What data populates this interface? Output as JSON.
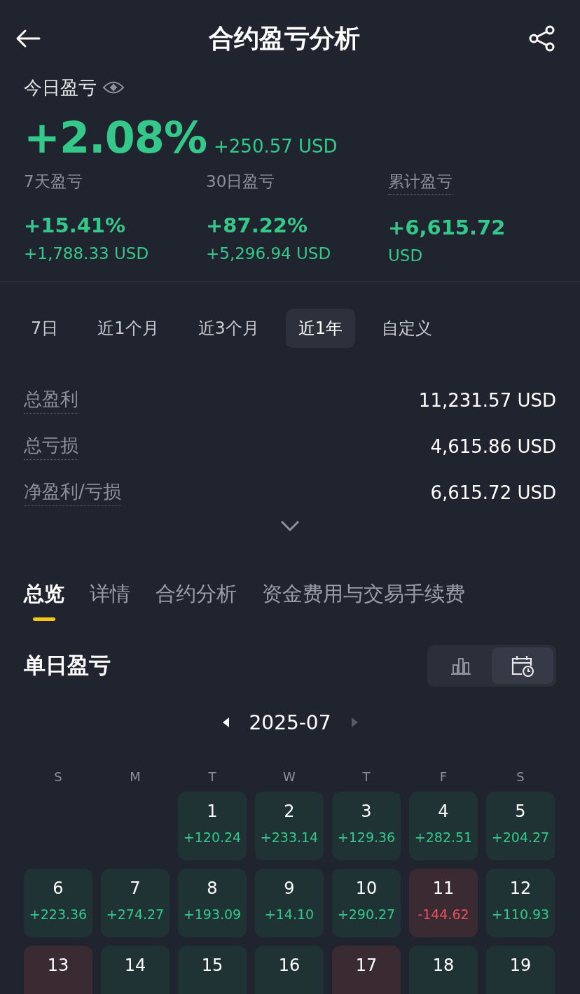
{
  "header": {
    "title": "合约盈亏分析"
  },
  "today": {
    "label": "今日盈亏",
    "percent": "+2.08%",
    "amount": "+250.57 USD"
  },
  "stats": [
    {
      "label": "7天盈亏",
      "underlined": false,
      "value": "+15.41%",
      "sub": "+1,788.33 USD"
    },
    {
      "label": "30日盈亏",
      "underlined": false,
      "value": "+87.22%",
      "sub": "+5,296.94 USD"
    },
    {
      "label": "累计盈亏",
      "underlined": true,
      "value": "+6,615.72",
      "sub": "USD"
    }
  ],
  "periods": [
    {
      "label": "7日",
      "selected": false
    },
    {
      "label": "近1个月",
      "selected": false
    },
    {
      "label": "近3个月",
      "selected": false
    },
    {
      "label": "近1年",
      "selected": true
    },
    {
      "label": "自定义",
      "selected": false
    }
  ],
  "summary": [
    {
      "label": "总盈利",
      "value": "11,231.57 USD"
    },
    {
      "label": "总亏损",
      "value": "4,615.86 USD"
    },
    {
      "label": "净盈利/亏损",
      "value": "6,615.72 USD"
    }
  ],
  "tabs": [
    {
      "label": "总览",
      "selected": true
    },
    {
      "label": "详情",
      "selected": false
    },
    {
      "label": "合约分析",
      "selected": false
    },
    {
      "label": "资金费用与交易手续费",
      "selected": false
    }
  ],
  "daily": {
    "title": "单日盈亏",
    "views": [
      {
        "kind": "bar-chart",
        "selected": false
      },
      {
        "kind": "calendar",
        "selected": true
      }
    ],
    "month": "2025-07",
    "prev": {
      "disabled": false
    },
    "next": {
      "disabled": true
    },
    "weekdays": [
      "S",
      "M",
      "T",
      "W",
      "T",
      "F",
      "S"
    ],
    "days": [
      {
        "kind": "empty"
      },
      {
        "kind": "empty"
      },
      {
        "kind": "day",
        "day": "1",
        "value": "+120.24",
        "loss": false
      },
      {
        "kind": "day",
        "day": "2",
        "value": "+233.14",
        "loss": false
      },
      {
        "kind": "day",
        "day": "3",
        "value": "+129.36",
        "loss": false
      },
      {
        "kind": "day",
        "day": "4",
        "value": "+282.51",
        "loss": false
      },
      {
        "kind": "day",
        "day": "5",
        "value": "+204.27",
        "loss": false
      },
      {
        "kind": "day",
        "day": "6",
        "value": "+223.36",
        "loss": false
      },
      {
        "kind": "day",
        "day": "7",
        "value": "+274.27",
        "loss": false
      },
      {
        "kind": "day",
        "day": "8",
        "value": "+193.09",
        "loss": false
      },
      {
        "kind": "day",
        "day": "9",
        "value": "+14.10",
        "loss": false
      },
      {
        "kind": "day",
        "day": "10",
        "value": "+290.27",
        "loss": false
      },
      {
        "kind": "day",
        "day": "11",
        "value": "-144.62",
        "loss": true
      },
      {
        "kind": "day",
        "day": "12",
        "value": "+110.93",
        "loss": false
      },
      {
        "kind": "day",
        "day": "13",
        "loss": true
      },
      {
        "kind": "day",
        "day": "14",
        "loss": false
      },
      {
        "kind": "day",
        "day": "15",
        "loss": false
      },
      {
        "kind": "day",
        "day": "16",
        "loss": false
      },
      {
        "kind": "day",
        "day": "17",
        "loss": true
      },
      {
        "kind": "day",
        "day": "18",
        "loss": false
      },
      {
        "kind": "day",
        "day": "19",
        "loss": false
      }
    ]
  }
}
